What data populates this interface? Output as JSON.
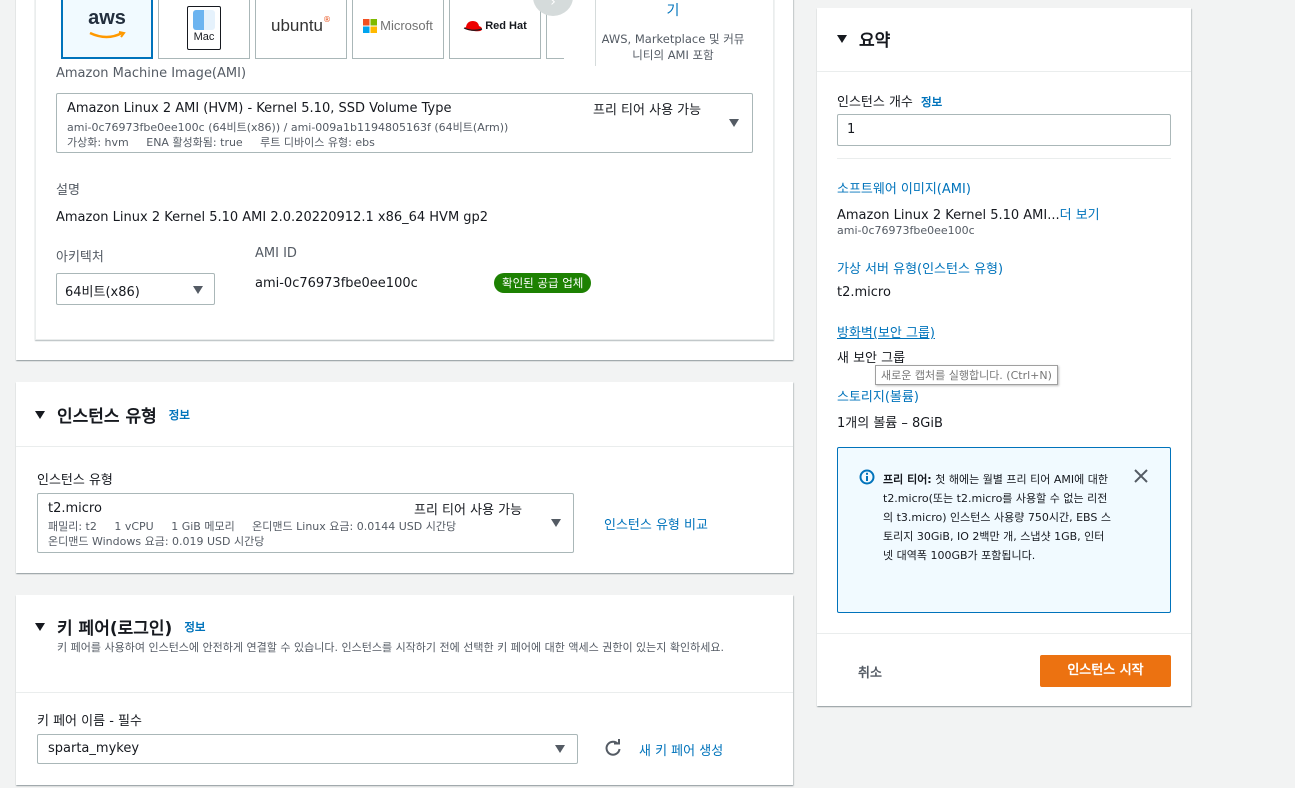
{
  "ami_section": {
    "logos": [
      {
        "name": "aws",
        "label": "aws"
      },
      {
        "name": "mac",
        "label": "Mac"
      },
      {
        "name": "ubuntu",
        "label": "ubuntu"
      },
      {
        "name": "microsoft",
        "label": "Microsoft"
      },
      {
        "name": "redhat",
        "label": "Red Hat"
      }
    ],
    "browse_more": {
      "title": "기",
      "subtitle": "AWS, Marketplace 및 커뮤니티의 AMI 포함"
    },
    "ami_label": "Amazon Machine Image(AMI)",
    "ami_select": {
      "title": "Amazon Linux 2 AMI (HVM) - Kernel 5.10, SSD Volume Type",
      "free_tier": "프리 티어 사용 가능",
      "ids": "ami-0c76973fbe0ee100c (64비트(x86)) / ami-009a1b1194805163f (64비트(Arm))",
      "details": "가상화: hvm     ENA 활성화됨: true     루트 디바이스 유형: ebs"
    },
    "description_label": "설명",
    "description_value": "Amazon Linux 2 Kernel 5.10 AMI 2.0.20220912.1 x86_64 HVM gp2",
    "arch_label": "아키텍처",
    "arch_value": "64비트(x86)",
    "ami_id_label": "AMI ID",
    "ami_id_value": "ami-0c76973fbe0ee100c",
    "verified_badge": "확인된 공급 업체"
  },
  "instance_type_section": {
    "title": "인스턴스 유형",
    "info": "정보",
    "field_label": "인스턴스 유형",
    "select": {
      "name": "t2.micro",
      "free_tier": "프리 티어 사용 가능",
      "line1": "패밀리: t2     1 vCPU     1 GiB 메모리     온디맨드 Linux 요금: 0.0144 USD 시간당",
      "line2": "온디맨드 Windows 요금: 0.019 USD 시간당"
    },
    "compare_link": "인스턴스 유형 비교"
  },
  "key_pair_section": {
    "title": "키 페어(로그인)",
    "info": "정보",
    "description": "키 페어를 사용하여 인스턴스에 안전하게 연결할 수 있습니다. 인스턴스를 시작하기 전에 선택한 키 페어에 대한 액세스 권한이 있는지 확인하세요.",
    "field_label": "키 페어 이름 - 필수",
    "value": "sparta_mykey",
    "create_link": "새 키 페어 생성"
  },
  "summary": {
    "title": "요약",
    "count_label": "인스턴스 개수",
    "count_info": "정보",
    "count_value": "1",
    "ami_link": "소프트웨어 이미지(AMI)",
    "ami_value": "Amazon Linux 2 Kernel 5.10 AMI...",
    "ami_more": "더 보기",
    "ami_id": "ami-0c76973fbe0ee100c",
    "type_link": "가상 서버 유형(인스턴스 유형)",
    "type_value": "t2.micro",
    "fw_link": "방화벽(보안 그룹)",
    "fw_value": "새 보안 그룹",
    "storage_link": "스토리지(볼륨)",
    "storage_value": "1개의 볼륨 – 8GiB",
    "tooltip": "새로운 캡처를 실행합니다. (Ctrl+N)",
    "free_tier_title": "프리 티어:",
    "free_tier_text": "첫 해에는 월별 프리 티어 AMI에 대한 t2.micro(또는 t2.micro를 사용할 수 없는 리전의 t3.micro) 인스턴스 사용량 750시간, EBS 스토리지 30GiB, IO 2백만 개, 스냅샷 1GB, 인터넷 대역폭 100GB가 포함됩니다.",
    "cancel": "취소",
    "launch": "인스턴스 시작"
  },
  "colors": {
    "accent": "#0073bb",
    "orange": "#ec7211",
    "green": "#1d8102"
  }
}
